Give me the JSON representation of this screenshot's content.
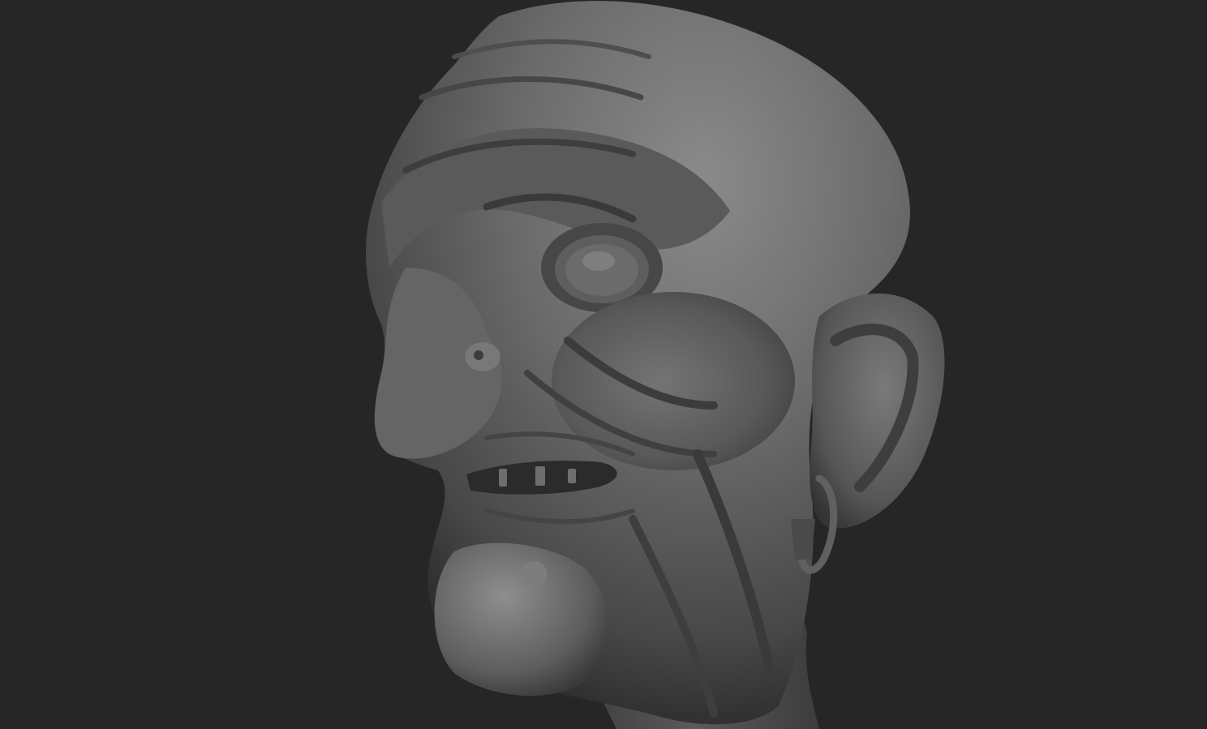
{
  "viewport": {
    "background_color": "#262626",
    "material_color": "#5c5c5c",
    "highlight_color": "#8a8a8a",
    "shadow_color": "#2c2c2c"
  },
  "model": {
    "subject": "sculpted-head-icon"
  }
}
